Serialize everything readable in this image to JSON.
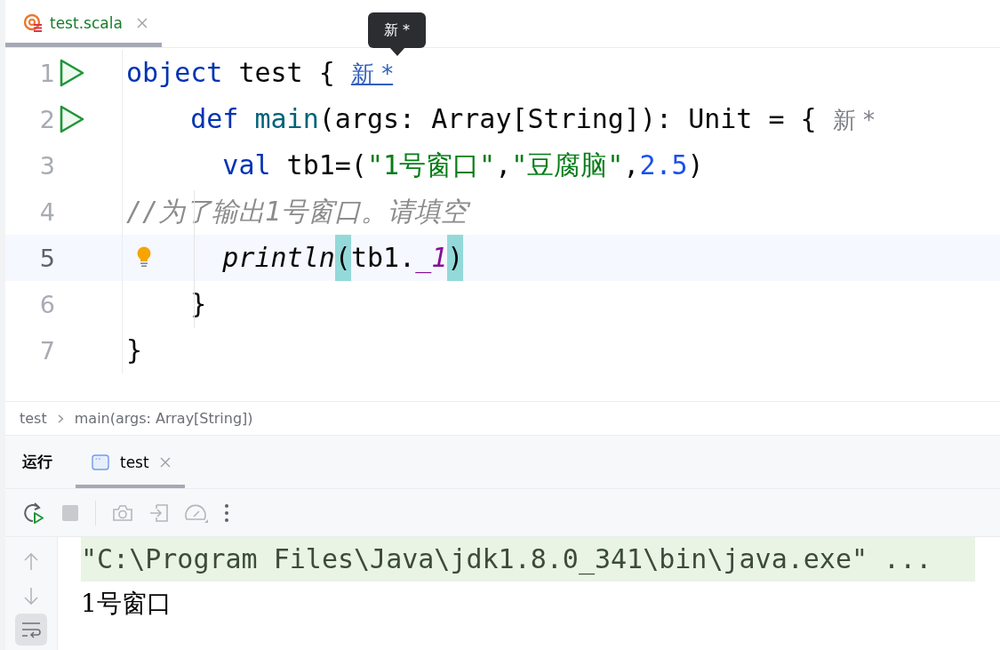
{
  "editor_tabs": [
    {
      "label": "test.scala",
      "selected": true
    }
  ],
  "tooltip": {
    "text": "新 *"
  },
  "code_lines": [
    {
      "number": "1",
      "runnable": true,
      "current": false,
      "tokens": [
        {
          "kind": "keyword",
          "text": "object"
        },
        {
          "kind": "plain",
          "text": " test { "
        },
        {
          "kind": "hint",
          "text": "新 *",
          "hovered": true
        }
      ]
    },
    {
      "number": "2",
      "runnable": true,
      "current": false,
      "tokens": [
        {
          "kind": "keyword",
          "text": "    def"
        },
        {
          "kind": "function",
          "text": " main"
        },
        {
          "kind": "plain",
          "text": "(args: Array[String]): Unit = { "
        },
        {
          "kind": "hint",
          "text": "新 *",
          "hovered": false
        }
      ]
    },
    {
      "number": "3",
      "current": false,
      "tokens": [
        {
          "kind": "keyword",
          "text": "      val"
        },
        {
          "kind": "plain",
          "text": " tb1=("
        },
        {
          "kind": "string",
          "text": "\"1号窗口\""
        },
        {
          "kind": "plain",
          "text": ","
        },
        {
          "kind": "string",
          "text": "\"豆腐脑\""
        },
        {
          "kind": "plain",
          "text": ","
        },
        {
          "kind": "number",
          "text": "2.5"
        },
        {
          "kind": "plain",
          "text": ")"
        }
      ]
    },
    {
      "number": "4",
      "current": false,
      "tokens": [
        {
          "kind": "comment",
          "text": "//为了输出1号窗口。请填空"
        }
      ]
    },
    {
      "number": "5",
      "intention": true,
      "current": true,
      "tokens": [
        {
          "kind": "call",
          "text": "      println"
        },
        {
          "kind": "paren",
          "text": "(",
          "highlighted": true
        },
        {
          "kind": "plain",
          "text": "tb1."
        },
        {
          "kind": "field",
          "text": "_1"
        },
        {
          "kind": "paren",
          "text": ")",
          "highlighted": true
        }
      ]
    },
    {
      "number": "6",
      "current": false,
      "tokens": [
        {
          "kind": "plain",
          "text": "    }"
        }
      ]
    },
    {
      "number": "7",
      "current": false,
      "tokens": [
        {
          "kind": "plain",
          "text": "}"
        }
      ]
    }
  ],
  "breadcrumbs": [
    "test",
    "main(args: Array[String])"
  ],
  "run_panel": {
    "title": "运行",
    "tabs": [
      {
        "label": "test",
        "selected": true
      }
    ]
  },
  "toolbar": [
    {
      "kind": "rerun",
      "disabled": false
    },
    {
      "kind": "stop",
      "disabled": true
    },
    {
      "kind": "separator"
    },
    {
      "kind": "camera",
      "disabled": true
    },
    {
      "kind": "exit",
      "disabled": true
    },
    {
      "kind": "gauge",
      "disabled": true
    },
    {
      "kind": "more",
      "disabled": false
    }
  ],
  "console_side": [
    {
      "kind": "up",
      "on": false
    },
    {
      "kind": "down",
      "on": false
    },
    {
      "kind": "wrap",
      "on": true
    }
  ],
  "console_lines": [
    {
      "kind": "command",
      "text": "\"C:\\Program Files\\Java\\jdk1.8.0_341\\bin\\java.exe\" ..."
    },
    {
      "kind": "output",
      "text": "1号窗口"
    }
  ]
}
